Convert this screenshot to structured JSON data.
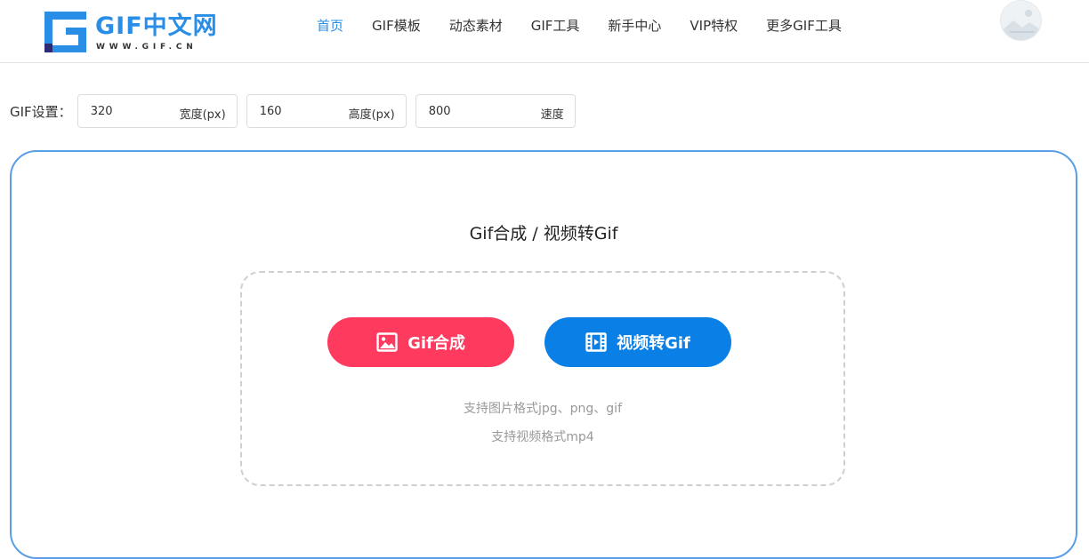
{
  "colors": {
    "accent": "#2a8ee6",
    "compose_button": "#fe3a5e",
    "video_button": "#0a80e6",
    "card_border": "#5a9ee8"
  },
  "header": {
    "logo": {
      "title": "GIF中文网",
      "subtitle": "WWW.GIF.CN"
    },
    "nav": [
      {
        "label": "首页",
        "active": true
      },
      {
        "label": "GIF模板",
        "active": false
      },
      {
        "label": "动态素材",
        "active": false
      },
      {
        "label": "GIF工具",
        "active": false
      },
      {
        "label": "新手中心",
        "active": false
      },
      {
        "label": "VIP特权",
        "active": false
      },
      {
        "label": "更多GIF工具",
        "active": false
      }
    ],
    "avatar_icon": "landscape-placeholder-icon"
  },
  "settings": {
    "label": "GIF设置：",
    "width": {
      "value": "320",
      "unit": "宽度(px)"
    },
    "height": {
      "value": "160",
      "unit": "高度(px)"
    },
    "speed": {
      "value": "800",
      "unit": "速度"
    }
  },
  "converter": {
    "title": "Gif合成 / 视频转Gif",
    "compose_button": {
      "label": "Gif合成",
      "icon": "image-icon"
    },
    "video_button": {
      "label": "视频转Gif",
      "icon": "film-icon"
    },
    "hint_images": "支持图片格式jpg、png、gif",
    "hint_video": "支持视频格式mp4"
  }
}
